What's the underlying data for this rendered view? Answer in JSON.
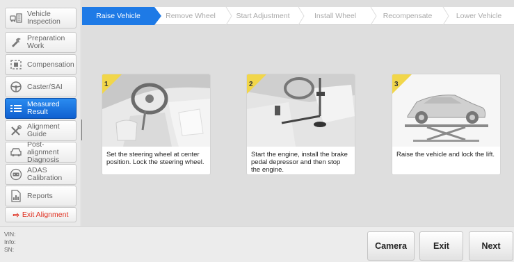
{
  "sidebar": {
    "items": [
      {
        "label": "Vehicle Inspection",
        "icon": "car-check-icon"
      },
      {
        "label": "Preparation Work",
        "icon": "wrench-icon"
      },
      {
        "label": "Compensation",
        "icon": "compensation-icon"
      },
      {
        "label": "Caster/SAI",
        "icon": "steering-wheel-icon"
      },
      {
        "label": "Measured Result",
        "icon": "list-icon"
      },
      {
        "label": "Alignment Guide",
        "icon": "tools-icon"
      },
      {
        "label": "Post-alignment Diagnosis",
        "icon": "car-icon"
      },
      {
        "label": "ADAS Calibration",
        "icon": "adas-icon"
      },
      {
        "label": "Reports",
        "icon": "report-icon"
      }
    ],
    "exit_label": "Exit Alignment",
    "active_index": 4
  },
  "steps": [
    "Raise Vehicle",
    "Remove Wheel",
    "Start Adjustment",
    "Install Wheel",
    "Recompensate",
    "Lower Vehicle"
  ],
  "cards": [
    {
      "number": "1",
      "text": "Set the steering wheel at center position. Lock the steering wheel."
    },
    {
      "number": "2",
      "text": "Start the engine, install the brake pedal depressor and then stop the engine."
    },
    {
      "number": "3",
      "text": "Raise the vehicle and lock the lift."
    }
  ],
  "footer": {
    "vin_label": "VIN:",
    "info_label": "Info:",
    "sn_label": "SN:",
    "camera_label": "Camera",
    "exit_label": "Exit",
    "next_label": "Next"
  },
  "colors": {
    "accent": "#1e7ae6",
    "exit": "#e03020",
    "step_number": "#f1d64a"
  }
}
